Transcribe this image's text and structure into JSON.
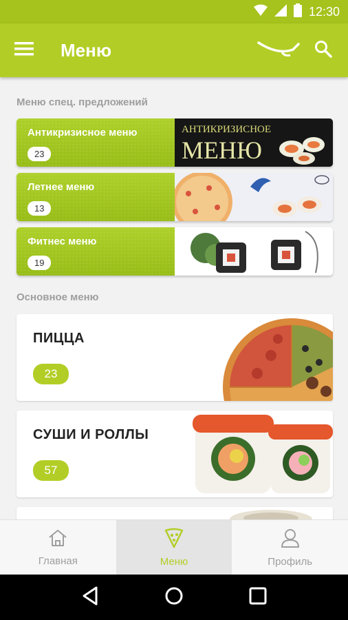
{
  "status": {
    "time": "12:30"
  },
  "appbar": {
    "title": "Меню"
  },
  "sections": {
    "special_title": "Меню спец. предложений",
    "main_title": "Основное меню"
  },
  "special": [
    {
      "name": "Антикризисное меню",
      "count": "23",
      "banner_text": "АНТИКРИЗИСНОЕ",
      "banner_text2": "МЕНЮ"
    },
    {
      "name": "Летнее меню",
      "count": "13"
    },
    {
      "name": "Фитнес меню",
      "count": "19"
    }
  ],
  "main": [
    {
      "name": "ПИЦЦА",
      "count": "23"
    },
    {
      "name": "СУШИ И РОЛЛЫ",
      "count": "57"
    },
    {
      "name": "",
      "count": ""
    }
  ],
  "bottom_nav": [
    {
      "label": "Главная",
      "icon": "home-icon"
    },
    {
      "label": "Меню",
      "icon": "pizza-slice-icon"
    },
    {
      "label": "Профиль",
      "icon": "profile-icon"
    }
  ],
  "colors": {
    "accent": "#b2ce26",
    "status_bar": "#a6c21c"
  }
}
